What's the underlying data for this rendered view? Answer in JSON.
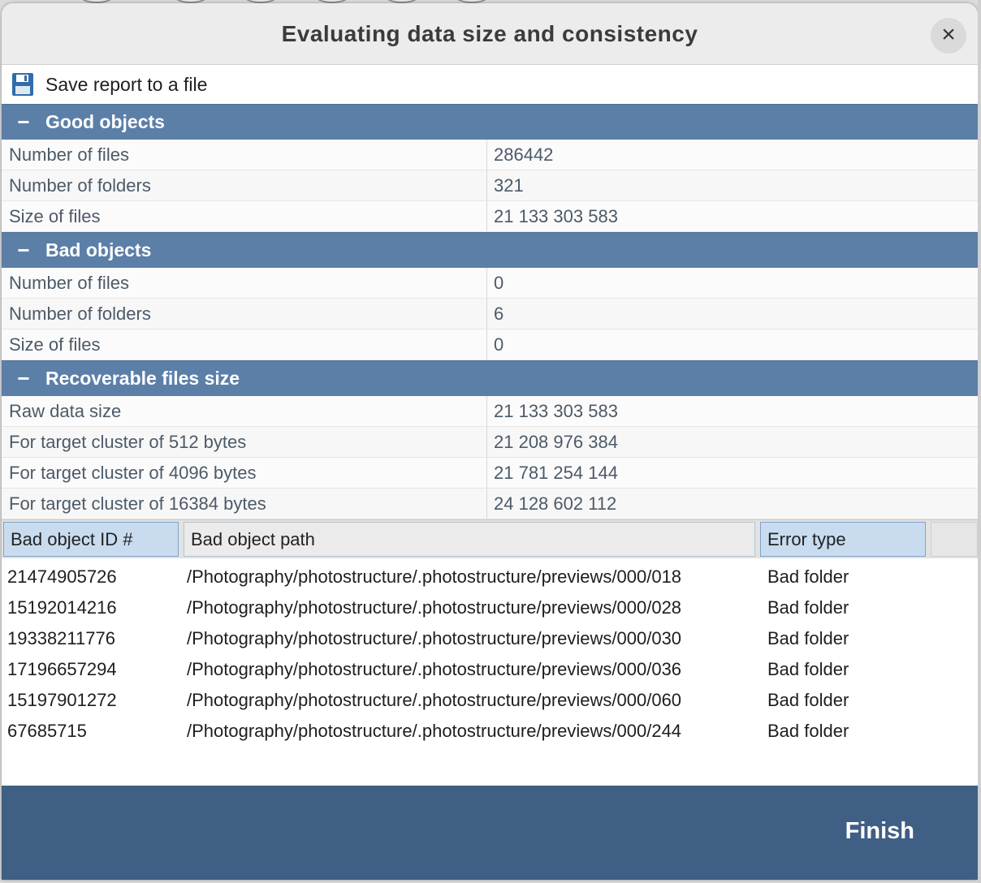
{
  "dialog": {
    "title": "Evaluating data size and consistency",
    "close_icon": "×"
  },
  "toolbar": {
    "save_label": "Save report to a file"
  },
  "sections": [
    {
      "title": "Good objects",
      "toggle": "−",
      "rows": [
        {
          "key": "Number of files",
          "value": "286442"
        },
        {
          "key": "Number of folders",
          "value": "321"
        },
        {
          "key": "Size of files",
          "value": "21 133 303 583"
        }
      ]
    },
    {
      "title": "Bad objects",
      "toggle": "−",
      "rows": [
        {
          "key": "Number of files",
          "value": "0"
        },
        {
          "key": "Number of folders",
          "value": "6"
        },
        {
          "key": "Size of files",
          "value": "0"
        }
      ]
    },
    {
      "title": "Recoverable files size",
      "toggle": "−",
      "rows": [
        {
          "key": "Raw data size",
          "value": "21 133 303 583"
        },
        {
          "key": "For target cluster of 512 bytes",
          "value": "21 208 976 384"
        },
        {
          "key": "For target cluster of 4096 bytes",
          "value": "21 781 254 144"
        },
        {
          "key": "For target cluster of 16384 bytes",
          "value": "24 128 602 112"
        }
      ]
    }
  ],
  "table": {
    "columns": [
      "Bad object ID #",
      "Bad object path",
      "Error type"
    ],
    "rows": [
      [
        "21474905726",
        "/Photography/photostructure/.photostructure/previews/000/018",
        "Bad folder"
      ],
      [
        "15192014216",
        "/Photography/photostructure/.photostructure/previews/000/028",
        "Bad folder"
      ],
      [
        "19338211776",
        "/Photography/photostructure/.photostructure/previews/000/030",
        "Bad folder"
      ],
      [
        "17196657294",
        "/Photography/photostructure/.photostructure/previews/000/036",
        "Bad folder"
      ],
      [
        "15197901272",
        "/Photography/photostructure/.photostructure/previews/000/060",
        "Bad folder"
      ],
      [
        "67685715",
        "/Photography/photostructure/.photostructure/previews/000/244",
        "Bad folder"
      ]
    ]
  },
  "footer": {
    "finish_label": "Finish"
  },
  "colors": {
    "section_header": "#5c7fa8",
    "footer": "#3f5f84",
    "active_column": "#c9dcef"
  },
  "icons": {
    "save": "floppy-disk-icon",
    "close": "close-icon",
    "collapse": "minus-icon"
  }
}
